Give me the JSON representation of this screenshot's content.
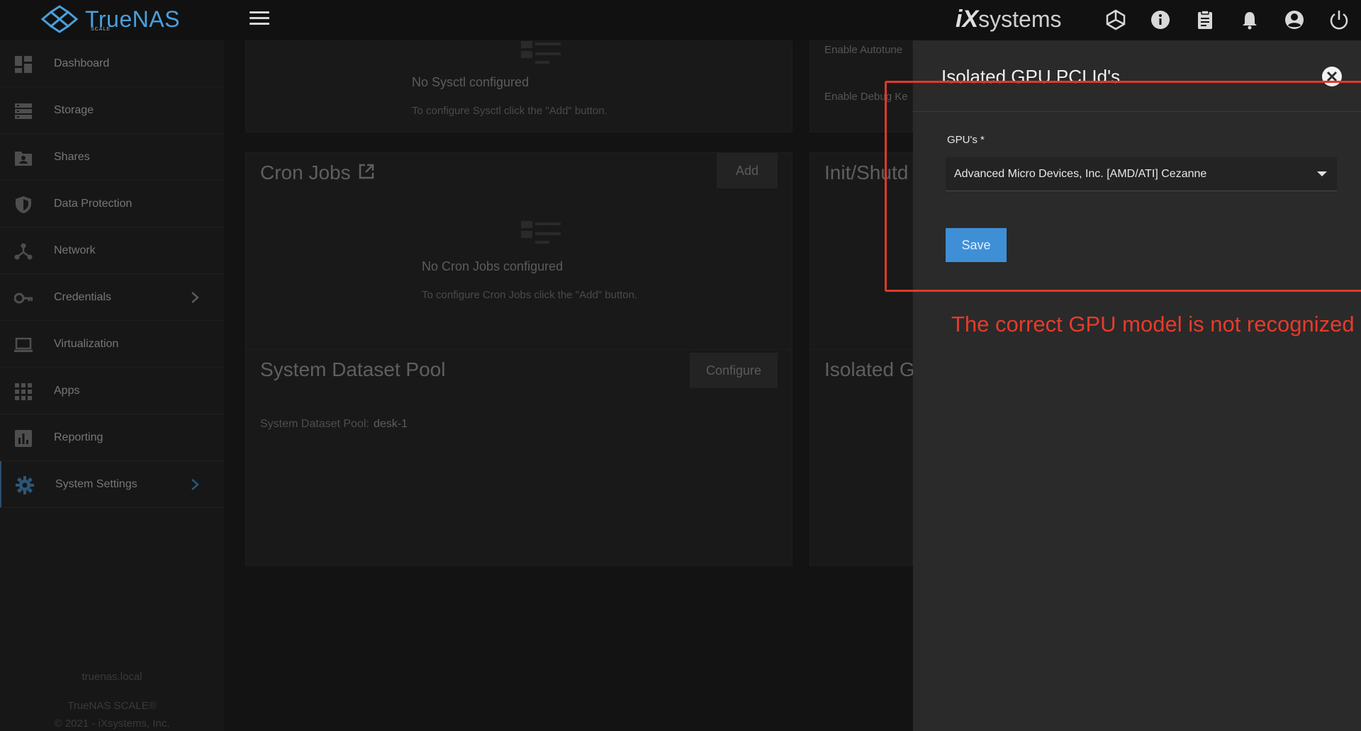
{
  "header": {
    "logo_name": "TrueNAS",
    "logo_sub": "SCALE",
    "ix_brand": "iX",
    "ix_systems": "systems",
    "icons": [
      "truecommand-icon",
      "info-icon",
      "clipboard-icon",
      "bell-icon",
      "account-icon",
      "power-icon"
    ]
  },
  "sidebar": {
    "items": [
      {
        "label": "Dashboard",
        "icon": "dashboard-icon"
      },
      {
        "label": "Storage",
        "icon": "storage-icon"
      },
      {
        "label": "Shares",
        "icon": "shares-icon"
      },
      {
        "label": "Data Protection",
        "icon": "shield-icon"
      },
      {
        "label": "Network",
        "icon": "network-icon"
      },
      {
        "label": "Credentials",
        "icon": "key-icon"
      },
      {
        "label": "Virtualization",
        "icon": "laptop-icon"
      },
      {
        "label": "Apps",
        "icon": "apps-grid-icon"
      },
      {
        "label": "Reporting",
        "icon": "reporting-icon"
      },
      {
        "label": "System Settings",
        "icon": "gear-icon"
      }
    ],
    "hostname": "truenas.local",
    "product": "TrueNAS SCALE®",
    "copyright": "© 2021 - iXsystems, Inc."
  },
  "main": {
    "sysctl": {
      "empty_title": "No Sysctl configured",
      "empty_text": "To configure Sysctl click the \"Add\" button."
    },
    "advanced": {
      "autotune": "Enable Autotune",
      "debug": "Enable Debug Ke"
    },
    "cron": {
      "title": "Cron Jobs",
      "add_label": "Add",
      "empty_title": "No Cron Jobs configured",
      "empty_text": "To configure Cron Jobs click the \"Add\" button."
    },
    "init_shutdown": {
      "title": "Init/Shutd"
    },
    "dataset_pool": {
      "title": "System Dataset Pool",
      "configure_label": "Configure",
      "pool_label": "System Dataset Pool:",
      "pool_value": "desk-1"
    },
    "isolated": {
      "title": "Isolated G"
    }
  },
  "panel": {
    "title": "Isolated GPU PCI Id's",
    "field_label": "GPU's *",
    "selected_gpu": "Advanced Micro Devices, Inc. [AMD/ATI] Cezanne",
    "save_label": "Save"
  },
  "annotation": {
    "text": "The correct GPU model is not recognized",
    "color": "#e83a2a"
  }
}
